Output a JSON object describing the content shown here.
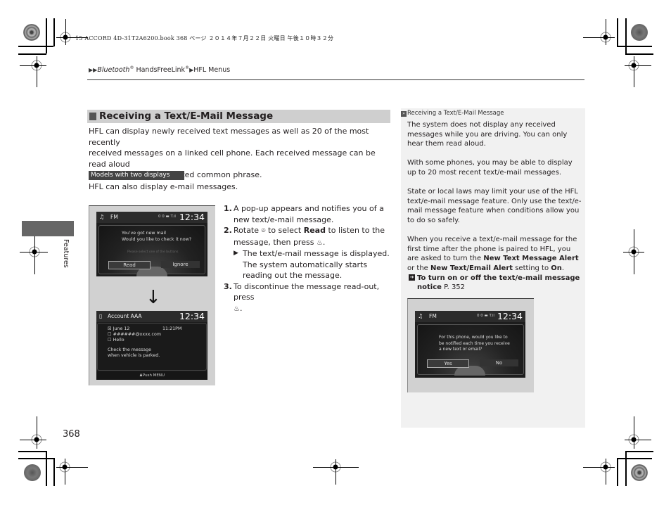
{
  "print_header": "15 ACCORD 4D-31T2A6200.book  368 ページ  ２０１４年７月２２日  火曜日  午後１０時３２分",
  "breadcrumb": {
    "prefix_icon": "double-triangle-icon",
    "items": [
      "Bluetooth",
      "HandsFreeLink",
      "HFL Menus"
    ],
    "reg_mark": "®"
  },
  "section": {
    "title": "Receiving a Text/E-Mail Message",
    "intro_lines": [
      "HFL can display newly received text messages as well as 20 of the most recently",
      "received messages on a linked cell phone. Each received message can be read aloud",
      "and replied to using a fixed common phrase."
    ],
    "model_tag": "Models with two displays",
    "model_note": "HFL can also display e-mail messages."
  },
  "figure1": {
    "screen1": {
      "source_label": "FM",
      "signal": "0 0 ▬ T.il",
      "clock": "12:34",
      "popup_lines": [
        "You've got new mail",
        "Would you like to check it now?"
      ],
      "popup_faint": "Please select one of the buttons",
      "buttons": [
        {
          "label": "Read",
          "selected": true
        },
        {
          "label": "Ignore",
          "selected": false
        }
      ]
    },
    "arrow": "↓",
    "screen2": {
      "account": "Account AAA",
      "clock": "12:34",
      "rows": [
        {
          "icon": "☒",
          "text": "June 12",
          "time": "11:21PM"
        },
        {
          "icon": "☐",
          "text": "######@xxxx.com"
        },
        {
          "icon": "☐",
          "text": "Hello"
        }
      ],
      "notice_lines": [
        "Check the message",
        "when vehicle is parked."
      ],
      "footer": "Push MENU"
    }
  },
  "steps": [
    {
      "num": "1.",
      "text": "A pop-up appears and notifies you of a new text/e-mail message."
    },
    {
      "num": "2.",
      "pre": "Rotate",
      "mid1": "to select",
      "bold": "Read",
      "mid2": "to listen to the message, then press",
      "post": ".",
      "result": "The text/e-mail message is displayed. The system automatically starts reading out the message."
    },
    {
      "num": "3.",
      "text": "To discontinue the message read-out, press",
      "post": "."
    }
  ],
  "side_tab": {
    "label": "Features"
  },
  "side_note": {
    "heading": "Receiving a Text/E-Mail Message",
    "paragraphs": [
      "The system does not display any received messages while you are driving. You can only hear them read aloud.",
      "With some phones, you may be able to display up to 20 most recent text/e-mail messages.",
      "State or local laws may limit your use of the HFL text/e-mail message feature. Only use the text/e-mail message feature when conditions allow you to do so safely."
    ],
    "p4": {
      "t1": "When you receive a text/e-mail message for the first time after the phone is paired to HFL, you are asked to turn the ",
      "b1": "New Text Message Alert",
      "t2": " or the ",
      "b2": "New Text/Email Alert",
      "t3": " setting to ",
      "b3": "On",
      "t4": "."
    },
    "xref": {
      "bold": "To turn on or off the text/e-mail message notice",
      "page": "P. 352"
    }
  },
  "figure2": {
    "source_label": "FM",
    "signal": "0 0 ▬ T.il",
    "clock": "12:34",
    "popup_lines": [
      "For this phone, would you like to",
      "be notified each time you receive",
      "a new text or email?"
    ],
    "buttons": [
      {
        "label": "Yes",
        "selected": true
      },
      {
        "label": "No",
        "selected": false
      }
    ]
  },
  "page_number": "368"
}
